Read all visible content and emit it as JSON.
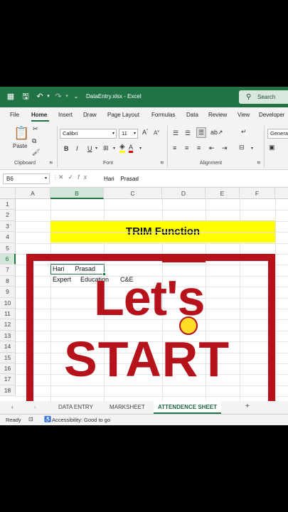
{
  "titlebar": {
    "filename": "DataEntry.xlsx - Excel",
    "search": "Search"
  },
  "tabs": [
    "File",
    "Home",
    "Insert",
    "Draw",
    "Page Layout",
    "Formulas",
    "Data",
    "Review",
    "View",
    "Developer"
  ],
  "ribbon": {
    "paste": "Paste",
    "groups": [
      "Clipboard",
      "Font",
      "Alignment"
    ],
    "font_name": "Calibri",
    "font_size": "11",
    "number_format": "General",
    "bold": "B",
    "italic": "I",
    "underline": "U"
  },
  "formula_bar": {
    "name_box": "B6",
    "content": "Hari    Prasad"
  },
  "columns": [
    "A",
    "B",
    "C",
    "D",
    "E",
    "F"
  ],
  "rows": [
    "1",
    "2",
    "3",
    "4",
    "5",
    "6",
    "7",
    "8",
    "9",
    "10",
    "11",
    "12",
    "13",
    "14",
    "15",
    "16",
    "17",
    "18"
  ],
  "cells": {
    "title": "TRIM Function",
    "b6": "Hari      Prasad",
    "b7": "Expert",
    "c7": "Education",
    "d7": "C&E"
  },
  "overlay": {
    "line1": "Let's",
    "line2": "START"
  },
  "sheets": [
    "DATA ENTRY",
    "MARKSHEET",
    "ATTENDENCE SHEET"
  ],
  "status": {
    "ready": "Ready",
    "accessibility": "Accessibility: Good to go"
  },
  "colors": {
    "excel_green": "#217346",
    "frame_red": "#b5121b",
    "title_fill": "#ffff00"
  }
}
